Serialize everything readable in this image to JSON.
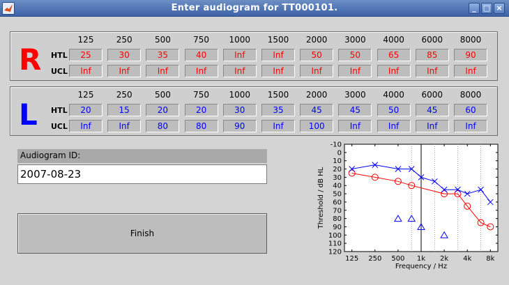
{
  "window": {
    "title": "Enter audiogram for TT000101."
  },
  "frequencies": [
    "125",
    "250",
    "500",
    "750",
    "1000",
    "1500",
    "2000",
    "3000",
    "4000",
    "6000",
    "8000"
  ],
  "right": {
    "letter": "R",
    "htl_label": "HTL",
    "ucl_label": "UCL",
    "htl": [
      "25",
      "30",
      "35",
      "40",
      "Inf",
      "Inf",
      "50",
      "50",
      "65",
      "85",
      "90"
    ],
    "ucl": [
      "Inf",
      "Inf",
      "Inf",
      "Inf",
      "Inf",
      "Inf",
      "Inf",
      "Inf",
      "Inf",
      "Inf",
      "Inf"
    ]
  },
  "left": {
    "letter": "L",
    "htl_label": "HTL",
    "ucl_label": "UCL",
    "htl": [
      "20",
      "15",
      "20",
      "20",
      "30",
      "35",
      "45",
      "45",
      "50",
      "45",
      "60"
    ],
    "ucl": [
      "Inf",
      "Inf",
      "80",
      "80",
      "90",
      "Inf",
      "100",
      "Inf",
      "Inf",
      "Inf",
      "Inf"
    ]
  },
  "audiogram_id": {
    "label": "Audiogram ID:",
    "value": "2007-08-23"
  },
  "finish_label": "Finish",
  "colors": {
    "right": "#ff0000",
    "left": "#0000ff"
  },
  "chart_data": {
    "type": "line",
    "xlabel": "Frequency / Hz",
    "ylabel": "Threshold / dB HL",
    "x_scale": "log",
    "y_inverted": true,
    "ylim": [
      -10,
      120
    ],
    "y_ticks": [
      "-10",
      "0",
      "10",
      "20",
      "30",
      "40",
      "50",
      "60",
      "70",
      "80",
      "90",
      "100",
      "110",
      "120"
    ],
    "x_tick_values": [
      125,
      250,
      500,
      1000,
      2000,
      4000,
      8000
    ],
    "x_tick_labels": [
      "125",
      "250",
      "500",
      "1k",
      "2k",
      "4k",
      "8k"
    ],
    "series": [
      {
        "marker": "circle",
        "color": "#ff0000",
        "x": [
          125,
          250,
          500,
          750,
          2000,
          3000,
          4000,
          6000,
          8000
        ],
        "y": [
          25,
          30,
          35,
          40,
          50,
          50,
          65,
          85,
          90
        ]
      },
      {
        "marker": "x",
        "color": "#0000ff",
        "x": [
          125,
          250,
          500,
          750,
          1000,
          1500,
          2000,
          3000,
          4000,
          6000,
          8000
        ],
        "y": [
          20,
          15,
          20,
          20,
          30,
          35,
          45,
          45,
          50,
          45,
          60
        ]
      },
      {
        "marker": "triangle",
        "color": "#0000ff",
        "x": [
          500,
          750,
          1000,
          2000
        ],
        "y": [
          80,
          80,
          90,
          100
        ]
      }
    ]
  }
}
